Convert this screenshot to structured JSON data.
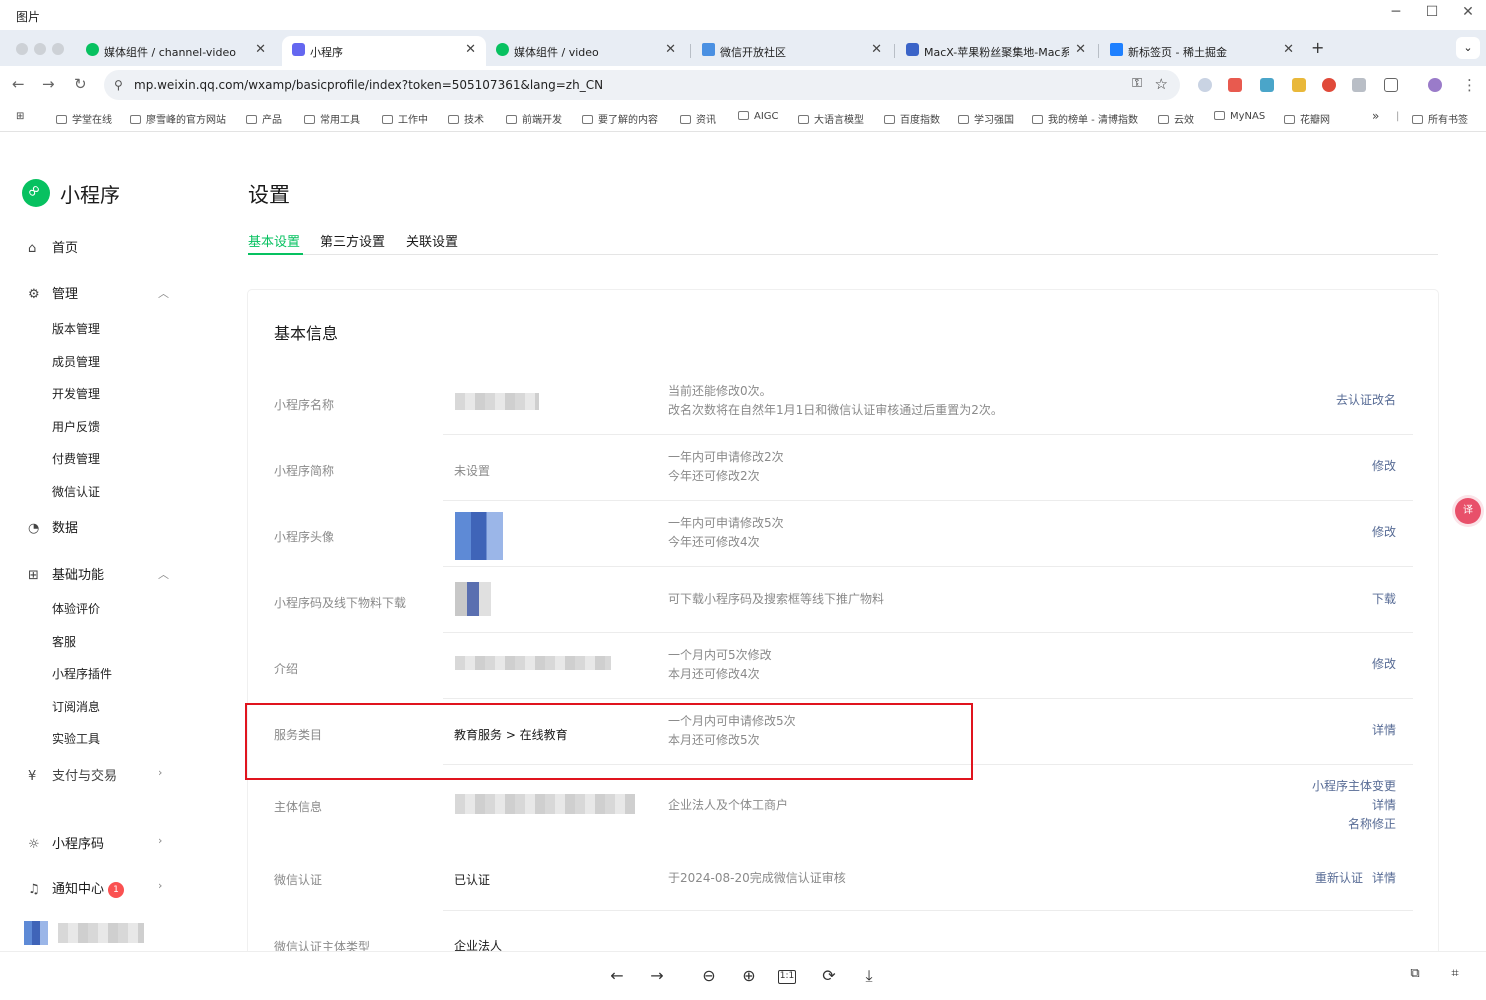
{
  "viewer": {
    "title": "图片",
    "min": "─",
    "max": "☐",
    "close": "✕"
  },
  "tabs": [
    {
      "label": "媒体组件 / channel-video",
      "color": "#07c160"
    },
    {
      "label": "小程序",
      "color": "#6467f0"
    },
    {
      "label": "媒体组件 / video",
      "color": "#07c160"
    },
    {
      "label": "微信开放社区",
      "color": "#4a90e2"
    },
    {
      "label": "MacX-苹果粉丝聚集地-Mac系统",
      "color": "#3b64c8"
    },
    {
      "label": "新标签页 - 稀土掘金",
      "color": "#1e80ff"
    }
  ],
  "tab_close": "✕",
  "new_tab": "+",
  "tab_dropdown": "⌄",
  "address": {
    "url": "mp.weixin.qq.com/wxamp/basicprofile/index?token=505107361&lang=zh_CN",
    "back": "←",
    "forward": "→",
    "reload": "↻",
    "site_icon": "⚲",
    "key_icon": "⚿",
    "star_icon": "☆",
    "menu": "⋮"
  },
  "bookmarks": [
    "学堂在线",
    "廖雪峰的官方网站",
    "产品",
    "常用工具",
    "工作中",
    "技术",
    "前端开发",
    "要了解的内容",
    "资讯",
    "AIGC",
    "大语言模型",
    "百度指数",
    "学习强国",
    "我的榜单 - 清博指数",
    "云效",
    "MyNAS",
    "花瓣网"
  ],
  "bookmarks_more": "»",
  "bookmarks_all": "所有书签",
  "sidebar": {
    "logo_text": "小程序",
    "home": "首页",
    "manage": "管理",
    "manage_items": [
      "版本管理",
      "成员管理",
      "开发管理",
      "用户反馈",
      "付费管理",
      "微信认证"
    ],
    "data": "数据",
    "basic": "基础功能",
    "basic_items": [
      "体验评价",
      "客服",
      "小程序插件",
      "订阅消息",
      "实验工具"
    ],
    "pay": "支付与交易",
    "qrcode": "小程序码",
    "notify": "通知中心",
    "notify_count": "1"
  },
  "main": {
    "title": "设置",
    "tabs": [
      "基本设置",
      "第三方设置",
      "关联设置"
    ],
    "card_title": "基本信息",
    "rows": [
      {
        "key": "小程序名称",
        "value": "",
        "desc": [
          "当前还能修改0次。",
          "改名次数将在自然年1月1日和微信认证审核通过后重置为2次。"
        ],
        "actions": [
          "去认证改名"
        ]
      },
      {
        "key": "小程序简称",
        "value": "未设置",
        "desc": [
          "一年内可申请修改2次",
          "今年还可修改2次"
        ],
        "actions": [
          "修改"
        ]
      },
      {
        "key": "小程序头像",
        "value": "",
        "desc": [
          "一年内可申请修改5次",
          "今年还可修改4次"
        ],
        "actions": [
          "修改"
        ]
      },
      {
        "key": "小程序码及线下物料下载",
        "value": "",
        "desc": [
          "可下载小程序码及搜索框等线下推广物料"
        ],
        "actions": [
          "下载"
        ]
      },
      {
        "key": "介绍",
        "value": "",
        "desc": [
          "一个月内可5次修改",
          "本月还可修改4次"
        ],
        "actions": [
          "修改"
        ]
      },
      {
        "key": "服务类目",
        "value": "教育服务 > 在线教育",
        "desc": [
          "一个月内可申请修改5次",
          "本月还可修改5次"
        ],
        "actions": [
          "详情"
        ]
      },
      {
        "key": "主体信息",
        "value": "",
        "desc": [
          "企业法人及个体工商户"
        ],
        "actions": [
          "小程序主体变更",
          "详情",
          "名称修正"
        ]
      },
      {
        "key": "微信认证",
        "value": "已认证",
        "desc": [
          "于2024-08-20完成微信认证审核"
        ],
        "actions": [
          "重新认证",
          "详情"
        ]
      },
      {
        "key": "微信认证主体类型",
        "value": "企业法人",
        "desc": [],
        "actions": []
      }
    ]
  },
  "viewer_bar": [
    "←",
    "→",
    "⊖",
    "⊕",
    "1:1",
    "⟳",
    "⤓"
  ],
  "colors": {
    "brand": "#07c160",
    "link": "#576b95",
    "highlight": "#e0141e"
  }
}
